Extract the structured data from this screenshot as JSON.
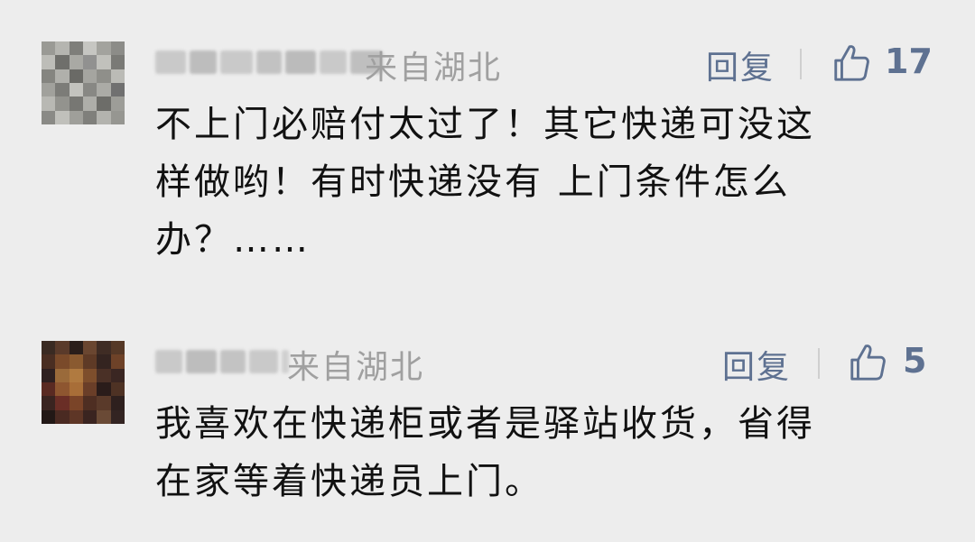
{
  "comments": [
    {
      "location": "来自湖北",
      "reply_label": "回复",
      "like_count": "17",
      "lines": [
        "不上门必赔付太过了！其它快递可没这",
        "样做哟！有时快递没有 上门条件怎么",
        "办？……"
      ]
    },
    {
      "location": "来自湖北",
      "reply_label": "回复",
      "like_count": "5",
      "lines": [
        "我喜欢在快递柜或者是驿站收货，省得",
        "在家等着快递员上门。"
      ]
    }
  ]
}
